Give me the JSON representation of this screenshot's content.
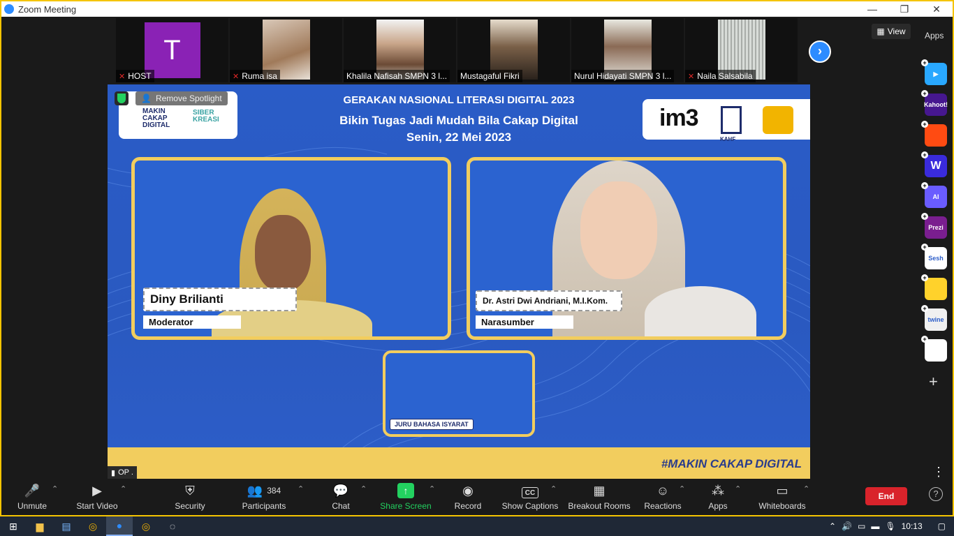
{
  "window": {
    "title": "Zoom Meeting",
    "controls": [
      "—",
      "❐",
      "✕"
    ]
  },
  "gallery": {
    "tiles": [
      {
        "name": "HOST",
        "muted": true,
        "kind": "avatar",
        "initial": "T",
        "avatar_color": "#8a22b5"
      },
      {
        "name": "Ruma isa",
        "muted": true,
        "kind": "video"
      },
      {
        "name": "Khalila Nafisah SMPN 3 l...",
        "muted": false,
        "kind": "video"
      },
      {
        "name": "Mustagaful Fikri",
        "muted": false,
        "kind": "video"
      },
      {
        "name": "Nurul Hidayati SMPN 3 l...",
        "muted": false,
        "kind": "video"
      },
      {
        "name": "Naila Salsabila",
        "muted": true,
        "kind": "video"
      }
    ],
    "next_icon": "›"
  },
  "view_button": {
    "label": "View"
  },
  "apps_label": "Apps",
  "stage": {
    "remove_spotlight": "Remove Spotlight",
    "banner_line1": "GERAKAN NASIONAL LITERASI DIGITAL 2023",
    "banner_line2": "Bikin Tugas Jadi Mudah Bila Cakap Digital",
    "banner_line3": "Senin, 22 Mei 2023",
    "logo_left_1": "MAKIN CAKAP DIGITAL",
    "logo_left_2": "SIBER KREASI",
    "logo_right_1": "im3",
    "logo_right_2": "KAHF",
    "moderator_name": "Diny Brilianti",
    "moderator_role": "Moderator",
    "speaker_name": "Dr. Astri Dwi Andriani, M.I.Kom.",
    "speaker_role": "Narasumber",
    "small_panel_label": "JURU BAHASA ISYARAT",
    "hashtag": "#MAKIN CAKAP DIGITAL",
    "signal_label": "OP ."
  },
  "side_apps": [
    {
      "label": "",
      "color": "#29a8ff",
      "icon": "play-icon"
    },
    {
      "label": "Kahoot!",
      "color": "#46178f",
      "icon": "kahoot-icon"
    },
    {
      "label": "",
      "color": "#ff4b12",
      "icon": "app-icon"
    },
    {
      "label": "W",
      "color": "#3a2bdc",
      "icon": "wooclap-icon"
    },
    {
      "label": "AI",
      "color": "#6a5cff",
      "icon": "ai-icon"
    },
    {
      "label": "Prezi",
      "color": "#7a1e8f",
      "icon": "prezi-icon"
    },
    {
      "label": "Sesh",
      "color": "#ffffff",
      "icon": "sesh-icon"
    },
    {
      "label": "",
      "color": "#ffd22b",
      "icon": "emoji-app-icon"
    },
    {
      "label": "twine",
      "color": "#f0f0f0",
      "icon": "twine-icon"
    },
    {
      "label": "",
      "color": "#ffffff",
      "icon": "blocks-icon"
    }
  ],
  "toolbar": {
    "unmute": "Unmute",
    "start_video": "Start Video",
    "security": "Security",
    "participants": "Participants",
    "participants_count": "384",
    "chat": "Chat",
    "share_screen": "Share Screen",
    "record": "Record",
    "show_captions": "Show Captions",
    "breakout_rooms": "Breakout Rooms",
    "reactions": "Reactions",
    "apps": "Apps",
    "whiteboards": "Whiteboards",
    "end": "End",
    "cc_glyph": "CC"
  },
  "taskbar": {
    "time": "10:13"
  }
}
